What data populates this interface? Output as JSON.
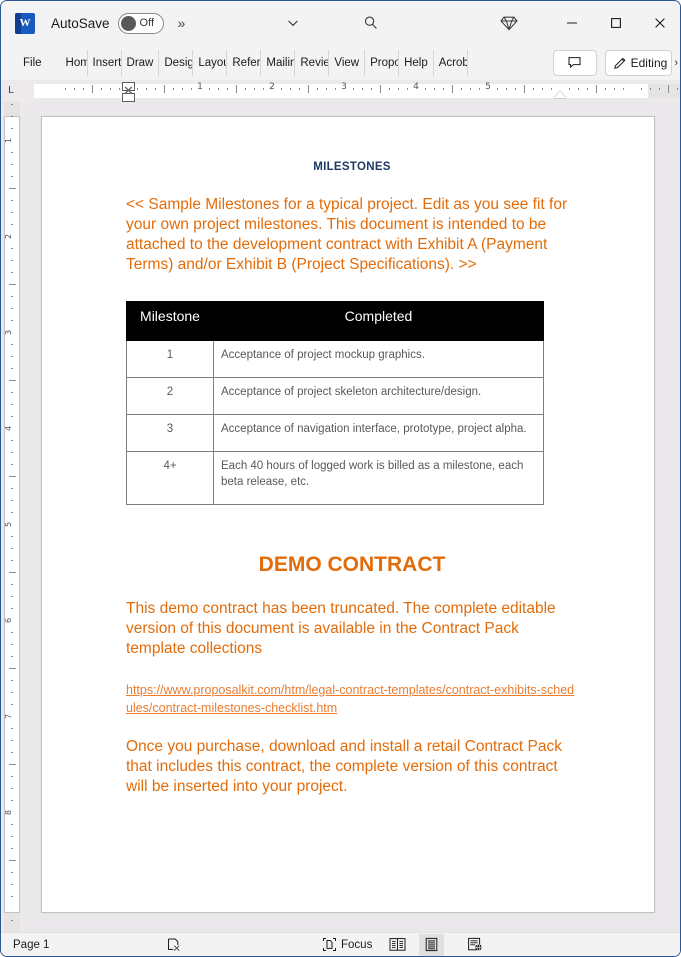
{
  "titlebar": {
    "app_icon": "word-icon",
    "autosave_label": "AutoSave",
    "autosave_state": "Off",
    "overflow_label": "»",
    "customize_icon": "chevron-down-icon",
    "search_icon": "search-icon",
    "diamond_icon": "diamond-icon",
    "minimize_icon": "minimize-icon",
    "maximize_icon": "maximize-icon",
    "close_icon": "close-icon"
  },
  "ribbon": {
    "tabs": [
      {
        "label": "File"
      },
      {
        "label": "Home"
      },
      {
        "label": "Insert"
      },
      {
        "label": "Draw"
      },
      {
        "label": "Design"
      },
      {
        "label": "Layout"
      },
      {
        "label": "References"
      },
      {
        "label": "Mailings"
      },
      {
        "label": "Review"
      },
      {
        "label": "View"
      },
      {
        "label": "Proposal Kit"
      },
      {
        "label": "Help"
      },
      {
        "label": "Acrobat"
      }
    ],
    "comments_icon": "comment-icon",
    "editing_label": "Editing",
    "editing_icon": "pencil-icon",
    "expand_icon": "chevron-right-icon"
  },
  "ruler": {
    "tab_stop_marker": "L",
    "horizontal_numbers": [
      "1",
      "2",
      "3",
      "4",
      "5"
    ],
    "vertical_numbers": [
      "1",
      "2",
      "3",
      "4",
      "5",
      "6",
      "7",
      "8"
    ]
  },
  "document": {
    "title": "MILESTONES",
    "intro_paragraph": "<< Sample Milestones for a typical project.  Edit as you see fit for your own project milestones.  This document is intended to be attached to the development contract with Exhibit A (Payment Terms) and/or Exhibit B (Project Specifications). >>",
    "table": {
      "headers": [
        "Milestone",
        "Completed"
      ],
      "rows": [
        {
          "milestone": "1",
          "completed": "Acceptance of project mockup graphics."
        },
        {
          "milestone": "2",
          "completed": "Acceptance of project skeleton architecture/design."
        },
        {
          "milestone": "3",
          "completed": "Acceptance of navigation interface, prototype, project alpha."
        },
        {
          "milestone": "4+",
          "completed": "Each 40 hours of logged work is billed as a milestone, each beta release, etc."
        }
      ]
    },
    "demo_title": "DEMO CONTRACT",
    "demo_paragraph": "This demo contract has been truncated. The complete editable version of this document is available in the Contract Pack template collections",
    "demo_link": "https://www.proposalkit.com/htm/legal-contract-templates/contract-exhibits-schedules/contract-milestones-checklist.htm",
    "closing_paragraph": "Once you purchase, download and install a retail Contract Pack that includes this contract, the complete version of this contract will be inserted into your project."
  },
  "statusbar": {
    "page_label": "Page 1",
    "proofing_icon": "proofing-errors-icon",
    "focus_label": "Focus",
    "focus_icon": "focus-icon",
    "view_read_icon": "read-mode-icon",
    "view_print_icon": "print-layout-icon",
    "view_web_icon": "web-layout-icon"
  },
  "colors": {
    "accent_orange": "#e36c0a",
    "link_orange": "#ec7c30",
    "title_blue": "#1f3864",
    "table_header_bg": "#000000",
    "window_border": "#2b579a"
  }
}
